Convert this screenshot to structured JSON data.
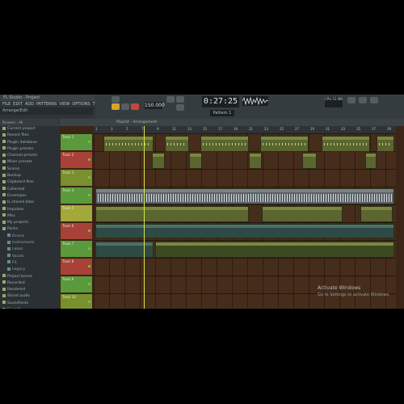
{
  "title": "FL Studio - Project",
  "menu": [
    "FILE",
    "EDIT",
    "ADD",
    "PATTERNS",
    "VIEW",
    "OPTIONS",
    "TOOLS",
    "?"
  ],
  "hint": "Arrange/Edit",
  "tempo": "150.000",
  "time": "0:27:25",
  "pattern": "Pattern 1",
  "cpu": "CPU 53 MB",
  "browser": {
    "header": "Browser - All",
    "items": [
      {
        "label": "Current project",
        "type": "folder"
      },
      {
        "label": "Recent files",
        "type": "folder"
      },
      {
        "label": "Plugin database",
        "type": "folder"
      },
      {
        "label": "Plugin presets",
        "type": "folder"
      },
      {
        "label": "Channel presets",
        "type": "folder"
      },
      {
        "label": "Mixer presets",
        "type": "folder"
      },
      {
        "label": "Scores",
        "type": "folder"
      },
      {
        "label": "Backup",
        "type": "folder"
      },
      {
        "label": "Clipboard files",
        "type": "folder"
      },
      {
        "label": "Collected",
        "type": "folder"
      },
      {
        "label": "Envelopes",
        "type": "folder"
      },
      {
        "label": "IL shared data",
        "type": "folder"
      },
      {
        "label": "Impulses",
        "type": "folder"
      },
      {
        "label": "Misc",
        "type": "folder"
      },
      {
        "label": "My projects",
        "type": "folder"
      },
      {
        "label": "Packs",
        "type": "folder"
      },
      {
        "label": "Drums",
        "type": "sub"
      },
      {
        "label": "Instruments",
        "type": "sub"
      },
      {
        "label": "Loops",
        "type": "sub"
      },
      {
        "label": "Vocals",
        "type": "sub"
      },
      {
        "label": "FX",
        "type": "sub"
      },
      {
        "label": "Legacy",
        "type": "sub"
      },
      {
        "label": "Project bones",
        "type": "folder"
      },
      {
        "label": "Recorded",
        "type": "folder"
      },
      {
        "label": "Rendered",
        "type": "folder"
      },
      {
        "label": "Sliced audio",
        "type": "folder"
      },
      {
        "label": "Soundfonts",
        "type": "folder"
      },
      {
        "label": "Speech",
        "type": "folder"
      }
    ]
  },
  "playlist": {
    "header": "Playlist - Arrangement",
    "ruler": [
      "1",
      "3",
      "5",
      "7",
      "9",
      "11",
      "13",
      "15",
      "17",
      "19",
      "21",
      "23",
      "25",
      "27",
      "29",
      "31",
      "33",
      "35",
      "37",
      "39"
    ],
    "tracks": [
      {
        "name": "Track 1",
        "color": "#5b9a3c"
      },
      {
        "name": "Track 2",
        "color": "#a84137"
      },
      {
        "name": "Track 3",
        "color": "#7a8f2e"
      },
      {
        "name": "Track 4",
        "color": "#5b9a3c"
      },
      {
        "name": "Track 5",
        "color": "#a3a83a"
      },
      {
        "name": "Track 6",
        "color": "#a84137"
      },
      {
        "name": "Track 7",
        "color": "#5b9a3c"
      },
      {
        "name": "Track 8",
        "color": "#a84137"
      },
      {
        "name": "Track 9",
        "color": "#5b9a3c"
      },
      {
        "name": "Track 10",
        "color": "#7a8f2e"
      }
    ]
  },
  "watermark": {
    "line1": "Activate Windows",
    "line2": "Go to Settings to activate Windows."
  }
}
